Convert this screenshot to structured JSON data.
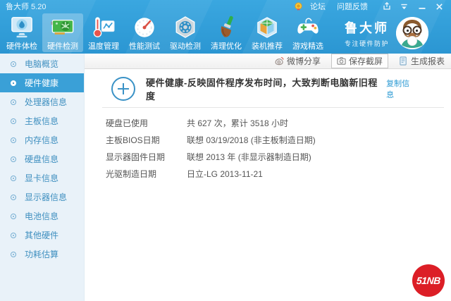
{
  "titlebar": {
    "title": "鲁大师 5.20",
    "links": [
      {
        "label": "论坛"
      },
      {
        "label": "问题反馈"
      }
    ]
  },
  "toolbar": {
    "tabs": [
      {
        "label": "硬件体检"
      },
      {
        "label": "硬件检测",
        "selected": true
      },
      {
        "label": "温度管理"
      },
      {
        "label": "性能测试"
      },
      {
        "label": "驱动检测"
      },
      {
        "label": "清理优化"
      },
      {
        "label": "装机推荐"
      },
      {
        "label": "游戏精选"
      }
    ],
    "brand": {
      "name": "鲁大师",
      "slogan": "专注硬件防护"
    }
  },
  "sidebar": {
    "items": [
      {
        "label": "电脑概览"
      },
      {
        "label": "硬件健康",
        "selected": true
      },
      {
        "label": "处理器信息"
      },
      {
        "label": "主板信息"
      },
      {
        "label": "内存信息"
      },
      {
        "label": "硬盘信息"
      },
      {
        "label": "显卡信息"
      },
      {
        "label": "显示器信息"
      },
      {
        "label": "电池信息"
      },
      {
        "label": "其他硬件"
      },
      {
        "label": "功耗估算"
      }
    ]
  },
  "actionbar": {
    "buttons": [
      {
        "label": "微博分享"
      },
      {
        "label": "保存截屏"
      },
      {
        "label": "生成报表"
      }
    ]
  },
  "main": {
    "title": "硬件健康-反映固件程序发布时间，大致判断电脑新旧程度",
    "copy_link": "复制信息",
    "rows": [
      {
        "label": "硬盘已使用",
        "value": "共 627 次，累计 3518 小时"
      },
      {
        "label": "主板BIOS日期",
        "value": "联想 03/19/2018 (非主板制造日期)"
      },
      {
        "label": "显示器固件日期",
        "value": "联想 2013 年 (非显示器制造日期)"
      },
      {
        "label": "光驱制造日期",
        "value": "日立-LG 2013-11-21"
      }
    ]
  },
  "watermark": {
    "label": "51NB"
  },
  "colors": {
    "accent": "#2f9fdb",
    "selected_blue": "#3aa0d7",
    "link": "#2b9ad3",
    "logo_red": "#dc1e26"
  }
}
